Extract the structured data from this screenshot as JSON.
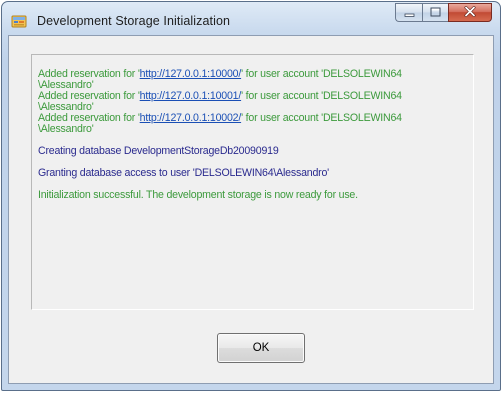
{
  "window": {
    "title": "Development Storage Initialization"
  },
  "log": {
    "reservations": [
      {
        "prefix": "Added reservation for '",
        "url": "http://127.0.0.1:10000/",
        "suffix": "' for user account 'DELSOLEWIN64",
        "wrap": "\\Alessandro'"
      },
      {
        "prefix": "Added reservation for '",
        "url": "http://127.0.0.1:10001/",
        "suffix": "' for user account 'DELSOLEWIN64",
        "wrap": "\\Alessandro'"
      },
      {
        "prefix": "Added reservation for '",
        "url": "http://127.0.0.1:10002/",
        "suffix": "' for user account 'DELSOLEWIN64",
        "wrap": "\\Alessandro'"
      }
    ],
    "creating_db": "Creating database DevelopmentStorageDb20090919",
    "granting_access": "Granting database access to user 'DELSOLEWIN64\\Alessandro'",
    "success": "Initialization successful. The development storage is now ready for use."
  },
  "buttons": {
    "ok_label": "OK"
  },
  "colors": {
    "success_text": "#3c9a3c",
    "info_text": "#2a2a8e",
    "link": "#1a4fb5"
  },
  "icons": {
    "app": "app-window-icon",
    "minimize": "minimize-icon",
    "maximize": "maximize-icon",
    "close": "close-icon"
  }
}
